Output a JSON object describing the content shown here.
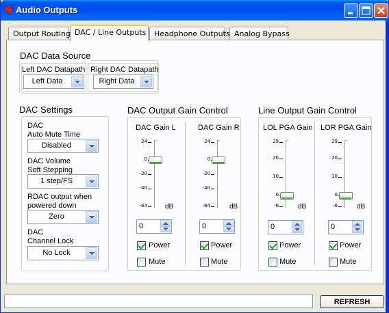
{
  "window": {
    "title": "Audio Outputs"
  },
  "tabs": [
    {
      "label": "Output Routing"
    },
    {
      "label": "DAC / Line Outputs"
    },
    {
      "label": "Headphone Outputs"
    },
    {
      "label": "Analog Bypass"
    }
  ],
  "active_tab": "DAC / Line Outputs",
  "dac_data_source": {
    "title": "DAC Data Source",
    "left_label": "Left DAC Datapath",
    "left_value": "Left Data",
    "right_label": "Right DAC Datapath",
    "right_value": "Right Data"
  },
  "dac_settings": {
    "title": "DAC Settings",
    "auto_mute_label_1": "DAC",
    "auto_mute_label_2": "Auto Mute Time",
    "auto_mute_value": "Disabled",
    "soft_step_label_1": "DAC Volume",
    "soft_step_label_2": "Soft Stepping",
    "soft_step_value": "1 step/FS",
    "rdac_label_1": "RDAC output when",
    "rdac_label_2": "powered down",
    "rdac_value": "Zero",
    "lock_label_1": "DAC",
    "lock_label_2": "Channel Lock",
    "lock_value": "No Lock"
  },
  "dac_gain": {
    "title": "DAC Output Gain Control",
    "channels": [
      {
        "label": "DAC Gain L",
        "ticks": [
          "24",
          "0",
          "-20",
          "-40",
          "-64"
        ],
        "unit": "dB",
        "value": "0",
        "slider_value": 0,
        "power_label": "Power",
        "power_checked": true,
        "mute_label": "Mute",
        "mute_checked": false
      },
      {
        "label": "DAC Gain R",
        "ticks": [
          "24",
          "0",
          "-20",
          "-40",
          "-64"
        ],
        "unit": "dB",
        "value": "0",
        "slider_value": 0,
        "power_label": "Power",
        "power_checked": true,
        "mute_label": "Mute",
        "mute_checked": false
      }
    ]
  },
  "line_gain": {
    "title": "Line Output Gain Control",
    "channels": [
      {
        "label": "LOL PGA Gain",
        "ticks": [
          "29",
          "20",
          "10",
          "0",
          "-6"
        ],
        "unit": "dB",
        "value": "0",
        "slider_value": 0,
        "power_label": "Power",
        "power_checked": true,
        "mute_label": "Mute",
        "mute_checked": false
      },
      {
        "label": "LOR PGA Gain",
        "ticks": [
          "29",
          "20",
          "10",
          "0",
          "-6"
        ],
        "unit": "dB",
        "value": "0",
        "slider_value": 0,
        "power_label": "Power",
        "power_checked": true,
        "mute_label": "Mute",
        "mute_checked": false
      }
    ]
  },
  "footer": {
    "status_text": "",
    "refresh_label": "REFRESH"
  },
  "colors": {
    "titlebar": "#0053ee",
    "panel": "#fcfcfe",
    "background": "#ece9d8",
    "active_tab_accent": "#ffc83c",
    "check": "#21a121"
  }
}
